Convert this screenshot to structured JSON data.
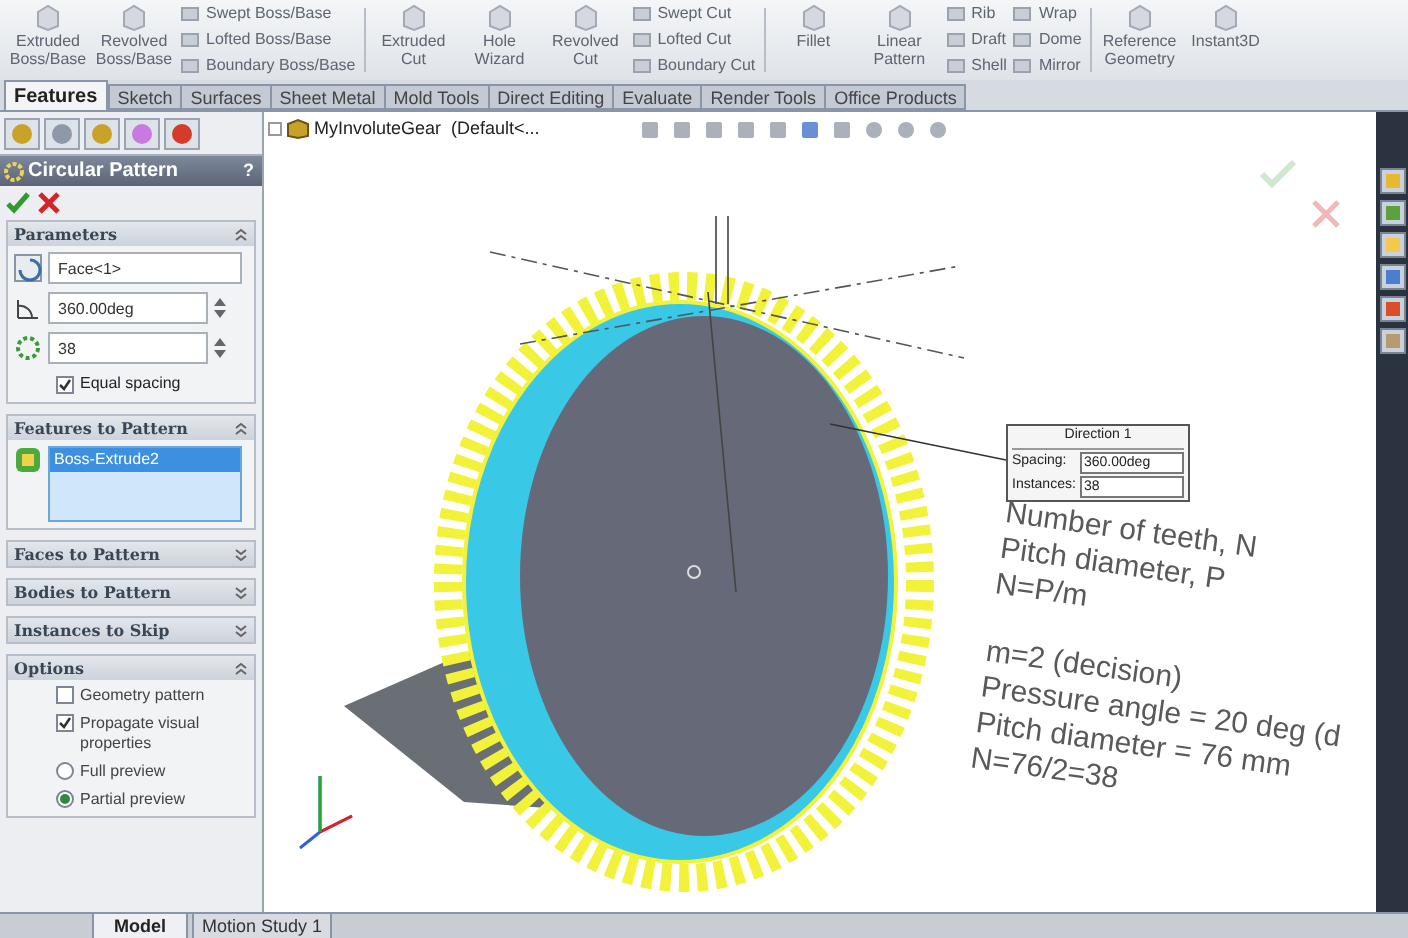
{
  "ribbon": {
    "groups": [
      [
        {
          "kind": "large",
          "label": "Extruded Boss/Base"
        },
        {
          "kind": "large",
          "label": "Revolved Boss/Base"
        },
        {
          "kind": "stack",
          "items": [
            "Swept Boss/Base",
            "Lofted Boss/Base",
            "Boundary Boss/Base"
          ]
        }
      ],
      [
        {
          "kind": "large",
          "label": "Extruded Cut"
        },
        {
          "kind": "large",
          "label": "Hole Wizard"
        },
        {
          "kind": "large",
          "label": "Revolved Cut"
        },
        {
          "kind": "stack",
          "items": [
            "Swept Cut",
            "Lofted Cut",
            "Boundary Cut"
          ]
        }
      ],
      [
        {
          "kind": "large",
          "label": "Fillet"
        },
        {
          "kind": "large",
          "label": "Linear Pattern"
        },
        {
          "kind": "stack",
          "items": [
            "Rib",
            "Draft",
            "Shell"
          ]
        },
        {
          "kind": "stack",
          "items": [
            "Wrap",
            "Dome",
            "Mirror"
          ]
        }
      ],
      [
        {
          "kind": "large",
          "label": "Reference Geometry"
        },
        {
          "kind": "large",
          "label": "Instant3D"
        }
      ]
    ]
  },
  "tabs": [
    {
      "label": "Features",
      "selected": true
    },
    {
      "label": "Sketch",
      "selected": false
    },
    {
      "label": "Surfaces",
      "selected": false
    },
    {
      "label": "Sheet Metal",
      "selected": false
    },
    {
      "label": "Mold Tools",
      "selected": false
    },
    {
      "label": "Direct Editing",
      "selected": false
    },
    {
      "label": "Evaluate",
      "selected": false
    },
    {
      "label": "Render Tools",
      "selected": false
    },
    {
      "label": "Office Products",
      "selected": false
    }
  ],
  "property_manager": {
    "title": "Circular Pattern",
    "help": "?",
    "sections": [
      {
        "title": "Parameters",
        "expanded": true,
        "kind": "parameters",
        "fields": [
          {
            "value": "Face<1>",
            "spinner": false
          },
          {
            "value": "360.00deg",
            "spinner": true
          },
          {
            "value": "38",
            "spinner": true
          }
        ],
        "checkbox": {
          "label": "Equal spacing",
          "checked": true
        }
      },
      {
        "title": "Features to Pattern",
        "expanded": true,
        "kind": "list",
        "items": [
          {
            "label": "Boss-Extrude2",
            "selected": true
          }
        ]
      },
      {
        "title": "Faces to Pattern",
        "expanded": false
      },
      {
        "title": "Bodies to Pattern",
        "expanded": false
      },
      {
        "title": "Instances to Skip",
        "expanded": false
      },
      {
        "title": "Options",
        "expanded": true,
        "kind": "options",
        "options": [
          {
            "kind": "checkbox",
            "label": "Geometry pattern",
            "checked": false
          },
          {
            "kind": "checkbox",
            "label": "Propagate visual properties",
            "checked": true
          },
          {
            "kind": "radio",
            "label": "Full preview",
            "checked": false
          },
          {
            "kind": "radio",
            "label": "Partial preview",
            "checked": true
          }
        ]
      }
    ]
  },
  "viewport": {
    "tree_root": "MyInvoluteGear  (Default<...",
    "callout": {
      "title": "Direction 1",
      "rows": [
        {
          "label": "Spacing:",
          "value": "360.00deg"
        },
        {
          "label": "Instances:",
          "value": "38"
        }
      ]
    },
    "notes": [
      [
        "Number of teeth, N",
        "Pitch diameter, P",
        "N=P/m"
      ],
      [
        "m=2 (decision)",
        "Pressure angle = 20 deg (d",
        "Pitch diameter = 76 mm",
        "N=76/2=38"
      ]
    ]
  },
  "bottom_tabs": [
    {
      "label": "Model",
      "selected": true
    },
    {
      "label": "Motion Study 1",
      "selected": false
    }
  ]
}
